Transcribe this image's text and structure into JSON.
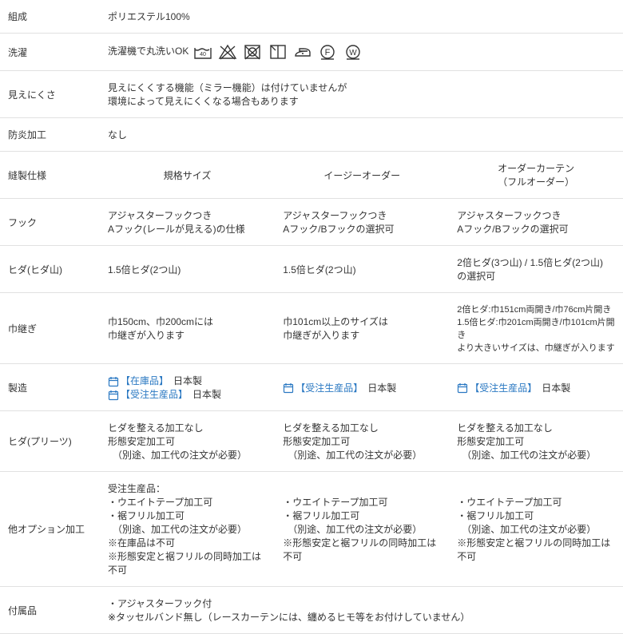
{
  "rows": {
    "composition": {
      "label": "組成",
      "value": "ポリエステル100%"
    },
    "wash": {
      "label": "洗濯",
      "value": "洗濯機で丸洗いOK"
    },
    "visibility": {
      "label": "見えにくさ",
      "line1": "見えにくくする機能（ミラー機能）は付けていませんが",
      "line2": "環境によって見えにくくなる場合もあります"
    },
    "fire": {
      "label": "防炎加工",
      "value": "なし"
    },
    "spec_hdr": {
      "label": "縫製仕様",
      "c1": "規格サイズ",
      "c2": "イージーオーダー",
      "c3": "オーダーカーテン",
      "c3sub": "（フルオーダー）"
    },
    "hook": {
      "label": "フック",
      "c1a": "アジャスターフックつき",
      "c1b": "Aフック(レールが見える)の仕様",
      "c2a": "アジャスターフックつき",
      "c2b": "Aフック/Bフックの選択可",
      "c3a": "アジャスターフックつき",
      "c3b": "Aフック/Bフックの選択可"
    },
    "pleat": {
      "label": "ヒダ(ヒダ山)",
      "c1": "1.5倍ヒダ(2つ山)",
      "c2": "1.5倍ヒダ(2つ山)",
      "c3a": "2倍ヒダ(3つ山) / 1.5倍ヒダ(2つ山)",
      "c3b": "の選択可"
    },
    "seam": {
      "label": "巾継ぎ",
      "c1a": "巾150cm、巾200cmには",
      "c1b": "巾継ぎが入ります",
      "c2a": "巾101cm以上のサイズは",
      "c2b": "巾継ぎが入ります",
      "c3a": "2倍ヒダ:巾151cm両開き/巾76cm片開き",
      "c3b": "1.5倍ヒダ:巾201cm両開き/巾101cm片開き",
      "c3c": "より大きいサイズは、巾継ぎが入ります"
    },
    "mfg": {
      "label": "製造",
      "stock": "【在庫品】",
      "mto": "【受注生産品】",
      "jp": "日本製"
    },
    "pleat2": {
      "label": "ヒダ(プリーツ)",
      "a": "ヒダを整える加工なし",
      "b": "形態安定加工可",
      "c": "（別途、加工代の注文が必要）"
    },
    "opt": {
      "label": "他オプション加工",
      "c1": [
        "受注生産品：",
        "・ウエイトテープ加工可",
        "・裾フリル加工可",
        "　（別途、加工代の注文が必要）",
        "※在庫品は不可",
        "※形態安定と裾フリルの同時加工は不可"
      ],
      "c2": [
        "・ウエイトテープ加工可",
        "・裾フリル加工可",
        "　（別途、加工代の注文が必要）",
        "※形態安定と裾フリルの同時加工は不可"
      ],
      "c3": [
        "・ウエイトテープ加工可",
        "・裾フリル加工可",
        "　（別途、加工代の注文が必要）",
        "※形態安定と裾フリルの同時加工は不可"
      ]
    },
    "acc": {
      "label": "付属品",
      "a": "・アジャスターフック付",
      "b": "※タッセルバンド無し（レースカーテンには、纏めるヒモ等をお付けしていません）"
    }
  }
}
